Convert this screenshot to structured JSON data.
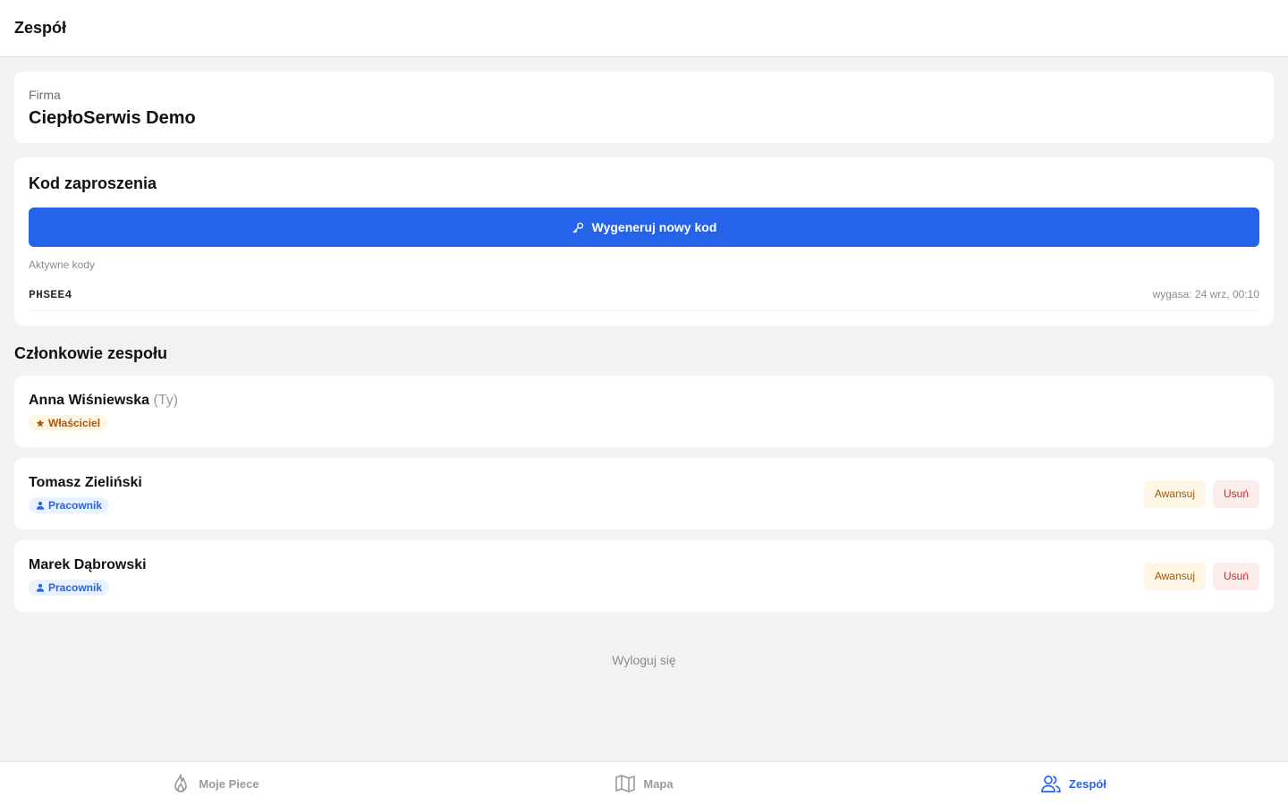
{
  "header": {
    "title": "Zespół"
  },
  "company": {
    "label": "Firma",
    "name": "CiepłoSerwis Demo"
  },
  "invite": {
    "title": "Kod zaproszenia",
    "generate_label": "Wygeneruj nowy kod",
    "active_label": "Aktywne kody",
    "codes": [
      {
        "code": "PHSEE4",
        "expiry": "wygasa: 24 wrz, 00:10"
      }
    ]
  },
  "members": {
    "title": "Członkowie zespołu",
    "list": [
      {
        "name": "Anna Wiśniewska",
        "you": "(Ty)",
        "role": "Właściciel"
      },
      {
        "name": "Tomasz Zieliński",
        "role": "Pracownik",
        "promote": "Awansuj",
        "remove": "Usuń"
      },
      {
        "name": "Marek Dąbrowski",
        "role": "Pracownik",
        "promote": "Awansuj",
        "remove": "Usuń"
      }
    ]
  },
  "logout_label": "Wyloguj się",
  "tabs": [
    {
      "label": "Moje Piece",
      "icon": "flame-icon"
    },
    {
      "label": "Mapa",
      "icon": "map-icon"
    },
    {
      "label": "Zespół",
      "icon": "users-icon",
      "active": true
    }
  ],
  "colors": {
    "accent": "#2563eb",
    "owner_badge_bg": "#fef6e4",
    "owner_badge_text": "#a8560a",
    "worker_badge_bg": "#ebf2ff",
    "remove_text": "#c62828",
    "promote_text": "#9a5a05"
  }
}
